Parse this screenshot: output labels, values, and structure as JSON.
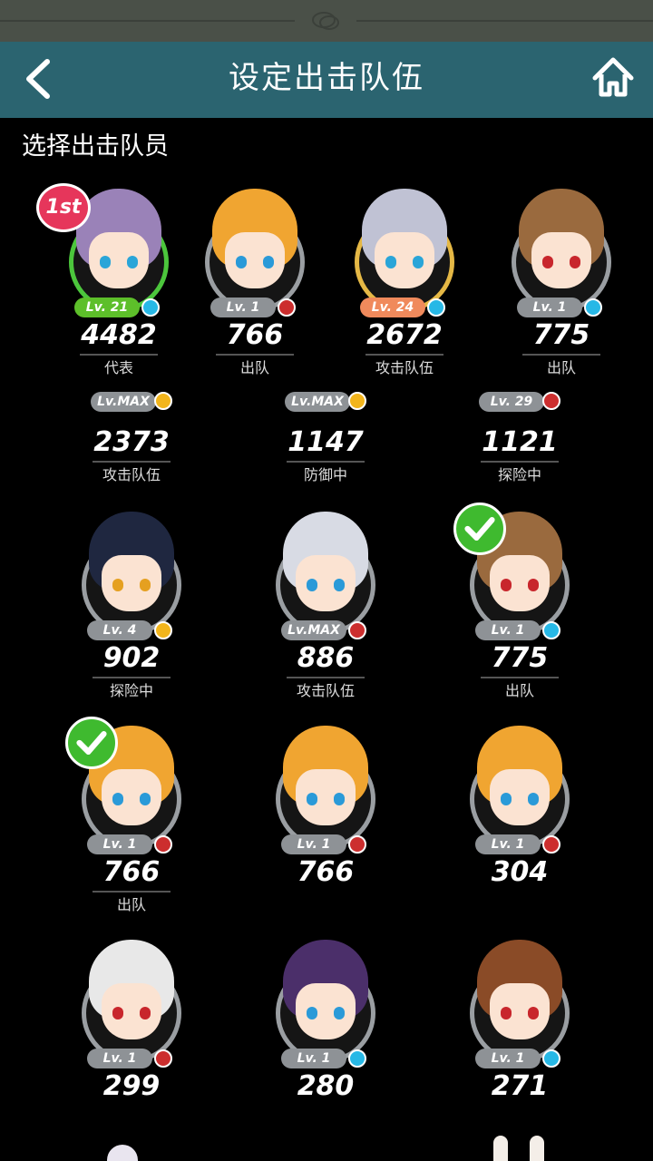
{
  "header": {
    "title": "设定出击队伍",
    "back_icon": "back-arrow-icon",
    "home_icon": "home-icon"
  },
  "section_title": "选择出击队员",
  "colors": {
    "titlebar": "#2b6470",
    "status_bar": "#4a5048",
    "rank_badge": "#e6365b",
    "check": "#3fba2f"
  },
  "characters": [
    {
      "id": "c1",
      "level": "Lv. 21",
      "power": "4482",
      "status": "代表",
      "rank": "1st",
      "type": "blue",
      "ring": "green",
      "pill": "green",
      "hair": "#9a82b8",
      "eye": "#2aa5d8"
    },
    {
      "id": "c2",
      "level": "Lv. 1",
      "power": "766",
      "status": "出队",
      "type": "red",
      "hair": "#f0a531",
      "eye": "#2a9ad8"
    },
    {
      "id": "c3",
      "level": "Lv. 24",
      "power": "2672",
      "status": "攻击队伍",
      "type": "blue",
      "ring": "gold",
      "pill": "orange",
      "hair": "#c0c2d4",
      "eye": "#2aa5d8"
    },
    {
      "id": "c4",
      "level": "Lv. 1",
      "power": "775",
      "status": "出队",
      "type": "blue",
      "hair": "#9a6a3e",
      "eye": "#c8262c"
    },
    {
      "id": "c5",
      "level": "Lv.MAX",
      "power": "2373",
      "status": "攻击队伍",
      "type": "yellow",
      "partial": true
    },
    {
      "id": "c6",
      "level": "Lv.MAX",
      "power": "1147",
      "status": "防御中",
      "type": "yellow",
      "partial": true
    },
    {
      "id": "c7",
      "level": "Lv. 29",
      "power": "1121",
      "status": "探险中",
      "type": "red",
      "partial": true
    },
    {
      "id": "c8",
      "level": "Lv. 4",
      "power": "902",
      "status": "探险中",
      "type": "yellow",
      "hair": "#1f2740",
      "eye": "#e5a020"
    },
    {
      "id": "c9",
      "level": "Lv.MAX",
      "power": "886",
      "status": "攻击队伍",
      "type": "red",
      "hair": "#d8dbe4",
      "eye": "#2a9ad8"
    },
    {
      "id": "c10",
      "level": "Lv. 1",
      "power": "775",
      "status": "出队",
      "type": "blue",
      "checked": true,
      "hair": "#9a6a3e",
      "eye": "#c8262c"
    },
    {
      "id": "c11",
      "level": "Lv. 1",
      "power": "766",
      "status": "出队",
      "type": "red",
      "checked": true,
      "hair": "#f0a531",
      "eye": "#2a9ad8"
    },
    {
      "id": "c12",
      "level": "Lv. 1",
      "power": "766",
      "status": "",
      "type": "red",
      "hair": "#f0a531",
      "eye": "#2a9ad8"
    },
    {
      "id": "c13",
      "level": "Lv. 1",
      "power": "304",
      "status": "",
      "type": "red",
      "hair": "#f0a531",
      "eye": "#2a9ad8"
    },
    {
      "id": "c14",
      "level": "Lv. 1",
      "power": "299",
      "status": "",
      "type": "red",
      "hair": "#e8e8e8",
      "eye": "#c8262c"
    },
    {
      "id": "c15",
      "level": "Lv. 1",
      "power": "280",
      "status": "",
      "type": "blue",
      "hair": "#4b2f6a",
      "eye": "#2a9ad8"
    },
    {
      "id": "c16",
      "level": "Lv. 1",
      "power": "271",
      "status": "",
      "type": "blue",
      "hair": "#8a4b27",
      "eye": "#c8262c"
    }
  ]
}
